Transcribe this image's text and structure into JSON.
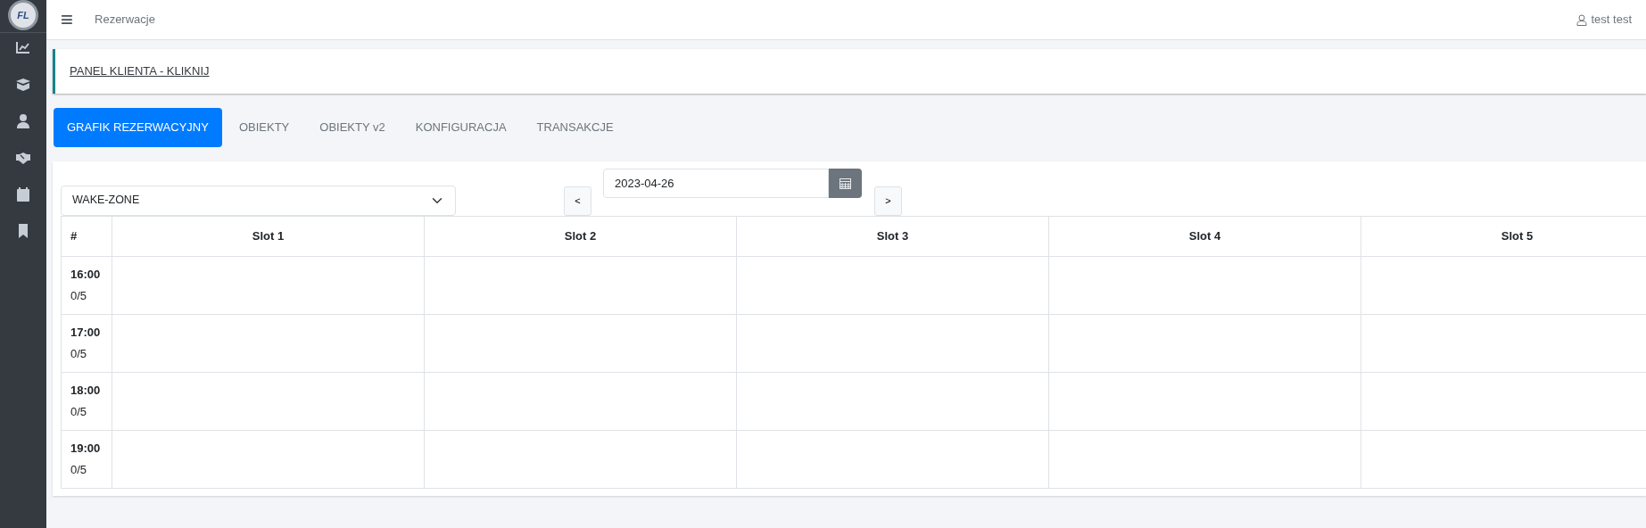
{
  "sidebar": {
    "logo": "FL",
    "items": [
      {
        "kind": "chart"
      },
      {
        "kind": "box"
      },
      {
        "kind": "person"
      },
      {
        "kind": "handshake"
      },
      {
        "kind": "calendar"
      },
      {
        "kind": "bookmark"
      }
    ]
  },
  "topbar": {
    "menu": "≡",
    "title": "Rezerwacje",
    "user": "test test"
  },
  "panel_link": "PANEL KLIENTA - KLIKNIJ",
  "tabs": [
    {
      "label": "GRAFIK REZERWACYJNY",
      "selected": true
    },
    {
      "label": "OBIEKTY",
      "selected": false
    },
    {
      "label": "OBIEKTY v2",
      "selected": false
    },
    {
      "label": "KONFIGURACJA",
      "selected": false
    },
    {
      "label": "TRANSAKCJE",
      "selected": false
    }
  ],
  "facility_select": {
    "value": "WAKE-ZONE"
  },
  "date_nav": {
    "prev": "<",
    "date": "2023-04-26",
    "next": ">"
  },
  "table": {
    "columns": [
      "#",
      "Slot 1",
      "Slot 2",
      "Slot 3",
      "Slot 4",
      "Slot 5"
    ],
    "rows": [
      {
        "time": "16:00",
        "count": "0/5"
      },
      {
        "time": "17:00",
        "count": "0/5"
      },
      {
        "time": "18:00",
        "count": "0/5"
      },
      {
        "time": "19:00",
        "count": "0/5"
      }
    ]
  }
}
